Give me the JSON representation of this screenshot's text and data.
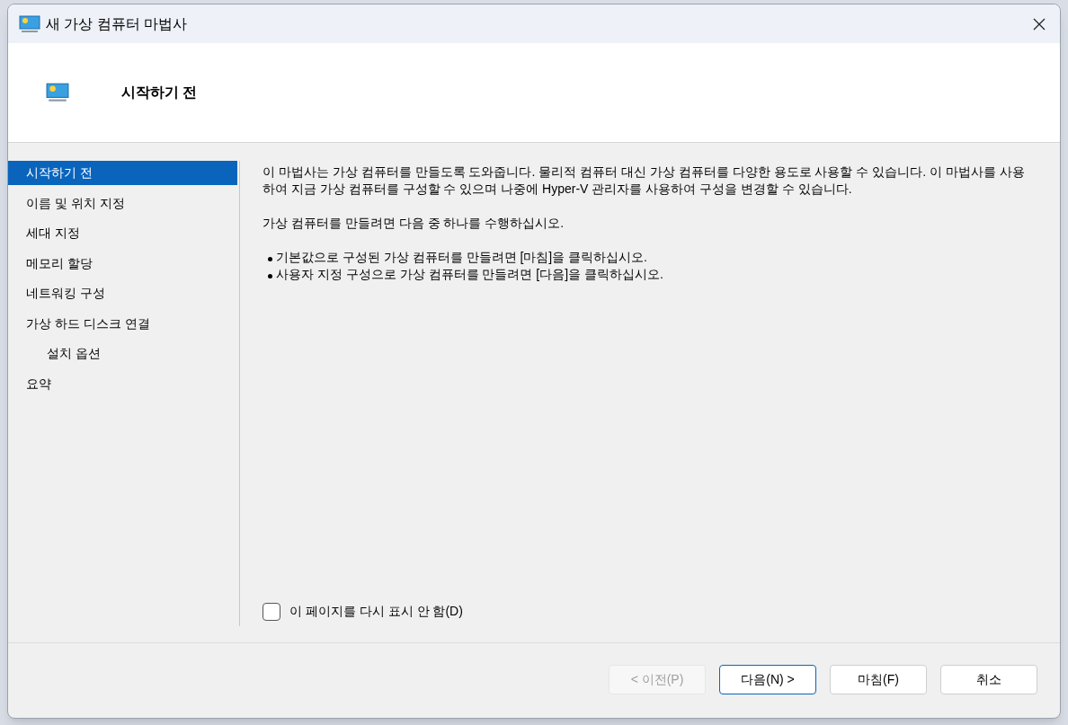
{
  "window": {
    "title": "새 가상 컴퓨터 마법사"
  },
  "header": {
    "title": "시작하기 전"
  },
  "sidebar": {
    "items": [
      {
        "label": "시작하기 전",
        "selected": true
      },
      {
        "label": "이름 및 위치 지정",
        "selected": false
      },
      {
        "label": "세대 지정",
        "selected": false
      },
      {
        "label": "메모리 할당",
        "selected": false
      },
      {
        "label": "네트워킹 구성",
        "selected": false
      },
      {
        "label": "가상 하드 디스크 연결",
        "selected": false,
        "children": [
          {
            "label": "설치 옵션",
            "selected": false
          }
        ]
      },
      {
        "label": "요약",
        "selected": false
      }
    ]
  },
  "content": {
    "paragraphs": [
      "이 마법사는 가상 컴퓨터를 만들도록 도와줍니다. 물리적 컴퓨터 대신 가상 컴퓨터를 다양한 용도로 사용할 수 있습니다. 이 마법사를 사용하여 지금 가상 컴퓨터를 구성할 수 있으며 나중에 Hyper-V 관리자를 사용하여 구성을 변경할 수 있습니다.",
      "가상 컴퓨터를 만들려면 다음 중 하나를 수행하십시오."
    ],
    "bullets": [
      "기본값으로 구성된 가상 컴퓨터를 만들려면 [마침]을 클릭하십시오.",
      "사용자 지정 구성으로 가상 컴퓨터를 만들려면 [다음]을 클릭하십시오."
    ]
  },
  "checkbox": {
    "label": "이 페이지를 다시 표시 안 함(D)",
    "checked": false
  },
  "buttons": [
    {
      "label": "< 이전(P)",
      "disabled": true,
      "default": false
    },
    {
      "label": "다음(N) >",
      "disabled": false,
      "default": true
    },
    {
      "label": "마침(F)",
      "disabled": false,
      "default": false
    },
    {
      "label": "취소",
      "disabled": false,
      "default": false
    }
  ]
}
